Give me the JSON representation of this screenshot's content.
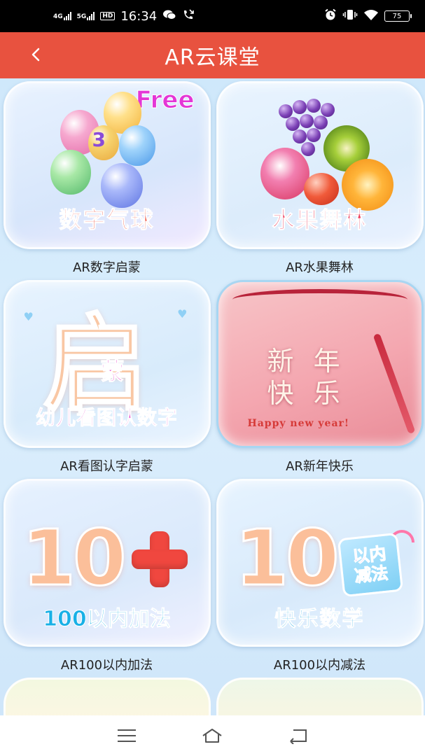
{
  "status_bar": {
    "network_1": "4G",
    "network_2": "5G",
    "hd": "HD",
    "time": "16:34",
    "battery": "75"
  },
  "header": {
    "title": "AR云课堂"
  },
  "courses": [
    {
      "label": "AR数字启蒙",
      "art_title": "数字气球",
      "badge": "Free",
      "balloon_number": "3"
    },
    {
      "label": "AR水果舞林",
      "art_title": "水果舞林"
    },
    {
      "label": "AR看图认字启蒙",
      "art_big": "启",
      "art_small": "蒙",
      "art_title": "幼儿看图认数字"
    },
    {
      "label": "AR新年快乐",
      "art_line1": "新 年",
      "art_line2": "快 乐",
      "art_sub": "Happy new year!"
    },
    {
      "label": "AR100以内加法",
      "art_big": "10",
      "art_title": "100以内加法"
    },
    {
      "label": "AR100以内减法",
      "art_big": "10",
      "art_box_1": "以内",
      "art_box_2": "减法",
      "art_title": "快乐数学"
    }
  ],
  "colors": {
    "header": "#e8523f",
    "background": "#cfe8fb"
  },
  "icons": {
    "back": "chevron-left-icon",
    "menu": "menu-icon",
    "home": "home-icon",
    "back_nav": "return-icon"
  }
}
